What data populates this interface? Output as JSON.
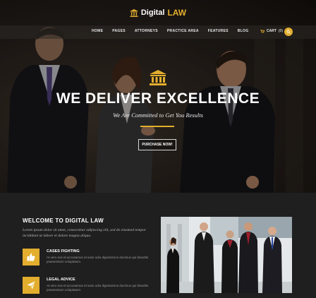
{
  "brand": {
    "part1": "Digital",
    "part2": "LAW"
  },
  "nav": {
    "items": [
      "HOME",
      "PAGES",
      "ATTORNEYS",
      "PRACTICE AREA",
      "FEATURES",
      "BLOG"
    ]
  },
  "cart": {
    "label": "CART",
    "count": "(0)"
  },
  "hero": {
    "headline": "WE DELIVER EXCELLENCE",
    "subheadline": "We Are Committed to Get You Results",
    "cta_label": "PURCHASE NOW!"
  },
  "welcome": {
    "title": "WELCOME TO DIGITAL LAW",
    "intro": "Lorem ipsum dolor sit amet, consectetur adipiscing elit, sed do eiusmod tempor incididunt ut labore et dolore magna aliqua."
  },
  "features": [
    {
      "title": "CASES FIGHTING",
      "text": "At vero eos et accusamus et iusto odio dignissimos ducimus qui blandits praesentium voluptatum.",
      "icon": "thumbs-up-icon"
    },
    {
      "title": "LEGAL ADVICE",
      "text": "At vero eos et accusamus et iusto odio dignissimos ducimus qui blandits praesentium voluptatum.",
      "icon": "paper-plane-icon"
    }
  ],
  "colors": {
    "accent": "#e3ae2e",
    "background": "#1f1f1f"
  }
}
